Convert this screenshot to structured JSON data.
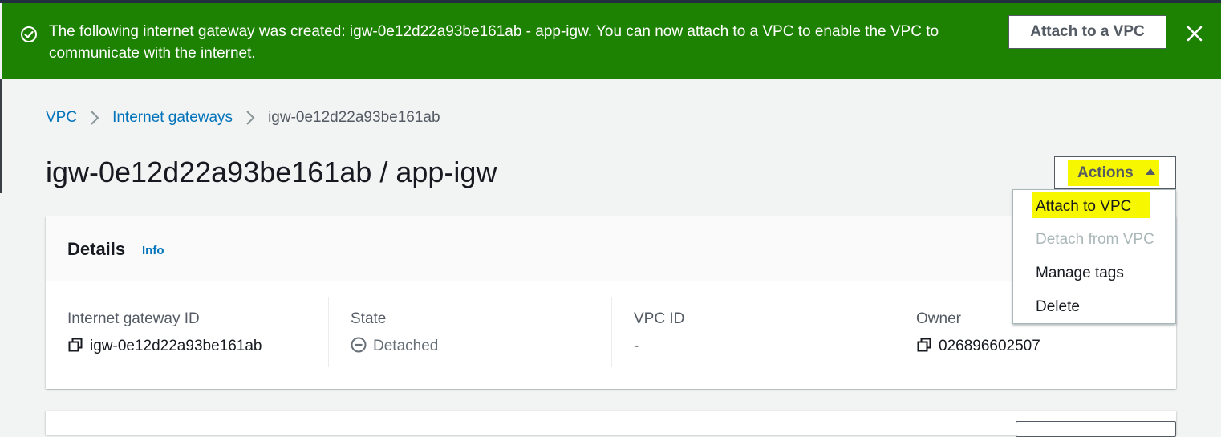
{
  "flash": {
    "message": "The following internet gateway was created: igw-0e12d22a93be161ab - app-igw. You can now attach to a VPC to enable the VPC to communicate with the internet.",
    "attach_button": "Attach to a VPC",
    "status_icon": "success-check-icon",
    "close_icon": "close-icon",
    "color": "#1d8102"
  },
  "breadcrumb": {
    "items": [
      "VPC",
      "Internet gateways",
      "igw-0e12d22a93be161ab"
    ]
  },
  "page": {
    "title": "igw-0e12d22a93be161ab / app-igw"
  },
  "actions": {
    "label": "Actions",
    "menu": [
      {
        "label": "Attach to VPC",
        "enabled": true,
        "highlighted": true
      },
      {
        "label": "Detach from VPC",
        "enabled": false
      },
      {
        "label": "Manage tags",
        "enabled": true
      },
      {
        "label": "Delete",
        "enabled": true
      }
    ]
  },
  "details": {
    "title": "Details",
    "info_link": "Info",
    "fields": [
      {
        "label": "Internet gateway ID",
        "value": "igw-0e12d22a93be161ab",
        "icon": "copy-icon"
      },
      {
        "label": "State",
        "value": "Detached",
        "icon": "detached-status-icon"
      },
      {
        "label": "VPC ID",
        "value": "-"
      },
      {
        "label": "Owner",
        "value": "026896602507",
        "icon": "copy-icon"
      }
    ]
  },
  "colors": {
    "link": "#0073bb",
    "highlight": "#f7f700",
    "text": "#16191f",
    "muted": "#545b64"
  }
}
